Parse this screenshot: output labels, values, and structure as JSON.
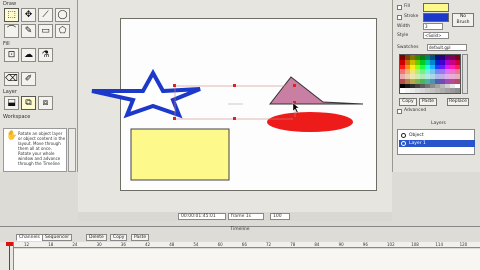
{
  "tools": {
    "section_draw": "Draw",
    "section_fill": "Fill",
    "section_layer": "Layer",
    "section_workspace": "Workspace",
    "draw_tools": [
      "⬚",
      "✥",
      "⟋",
      "◯",
      "⌒",
      "✎",
      "▭",
      "⬠"
    ],
    "fill_tools": [
      "⊡",
      "☁",
      "⚗"
    ],
    "layer_tools": [
      "⬓",
      "⧉",
      "⧈"
    ],
    "help_text": "Rotate an object layer or object content in the layout. Move through them all at once. Rotate your whole window and advance through the Timeline"
  },
  "status": {
    "frame_info": "00:00:01:45:01",
    "frame_label": "frame 1s",
    "zoom": "100"
  },
  "properties": {
    "fill_label": "Fill",
    "stroke_label": "Stroke",
    "width_label": "Width",
    "width_value": "3",
    "style_label": "Style",
    "style_value": "<Solid>",
    "no_brush_label": "No Brush",
    "swatches_label": "Swatches",
    "swatches_select": "default.gpl",
    "copy_btn": "Copy",
    "paste_btn": "Paste",
    "replace_btn": "Replace",
    "advanced_label": "Advanced",
    "fill_color": "#fdf98a",
    "stroke_color": "#1c39c9"
  },
  "layers": {
    "title": "Layers",
    "items": [
      {
        "name": "Object"
      },
      {
        "name": "Layer 1"
      }
    ]
  },
  "timeline": {
    "title": "Timeline",
    "tabs": [
      "Channels",
      "Sequencer",
      "Delete",
      "Copy",
      "Paste"
    ],
    "ruler": [
      "12",
      "18",
      "24",
      "30",
      "36",
      "42",
      "48",
      "54",
      "60",
      "66",
      "72",
      "78",
      "84",
      "90",
      "96",
      "102",
      "108",
      "114",
      "120"
    ]
  }
}
